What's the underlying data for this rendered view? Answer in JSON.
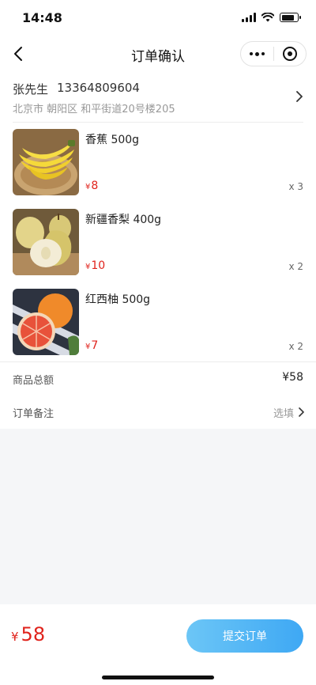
{
  "status_bar": {
    "time": "14:48"
  },
  "nav": {
    "title": "订单确认",
    "more_icon": "more-dots-icon",
    "close_icon": "target-circle-icon"
  },
  "address": {
    "name": "张先生",
    "phone": "13364809604",
    "detail": "北京市 朝阳区 和平街道20号楼205"
  },
  "goods": [
    {
      "name": "香蕉 500g",
      "currency": "¥",
      "price": "8",
      "qty": "x 3",
      "image": "banana-image"
    },
    {
      "name": "新疆香梨 400g",
      "currency": "¥",
      "price": "10",
      "qty": "x 2",
      "image": "pear-image"
    },
    {
      "name": "红西柚 500g",
      "currency": "¥",
      "price": "7",
      "qty": "x 2",
      "image": "grapefruit-image"
    }
  ],
  "summary": {
    "total_label": "商品总额",
    "total_value": "¥58",
    "remark_label": "订单备注",
    "remark_hint": "选填"
  },
  "bottom": {
    "currency": "¥",
    "total": "58",
    "submit_label": "提交订单"
  },
  "colors": {
    "price": "#e0231c",
    "button_from": "#6cc6f6",
    "button_to": "#3ea8f4",
    "page_bg": "#f5f6f8"
  }
}
